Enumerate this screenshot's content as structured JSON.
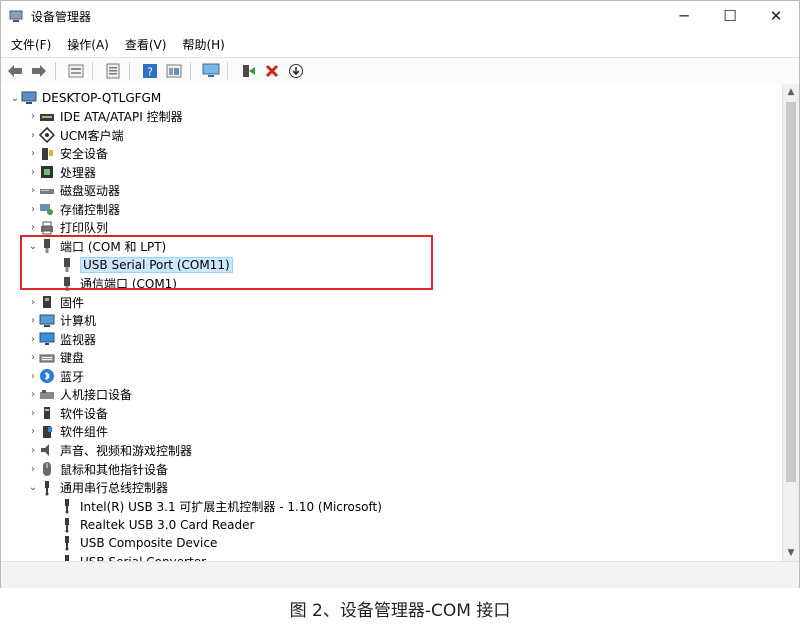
{
  "window": {
    "title": "设备管理器",
    "controls": {
      "minimize": "─",
      "maximize": "☐",
      "close": "✕"
    }
  },
  "menu": [
    "文件(F)",
    "操作(A)",
    "查看(V)",
    "帮助(H)"
  ],
  "toolbar": {
    "buttons": [
      {
        "name": "back-icon",
        "glyph": "⇦"
      },
      {
        "name": "forward-icon",
        "glyph": "⇨"
      },
      {
        "name": "properties-icon",
        "glyph": "▤"
      },
      {
        "name": "update-driver-icon",
        "glyph": "▦"
      },
      {
        "name": "help-icon",
        "glyph": "?"
      },
      {
        "name": "view-icon",
        "glyph": "▤"
      },
      {
        "name": "scan-hardware-icon",
        "glyph": "🖵"
      },
      {
        "name": "enable-device-icon",
        "glyph": "▲"
      },
      {
        "name": "uninstall-icon",
        "glyph": "✕"
      },
      {
        "name": "download-icon",
        "glyph": "⊕"
      }
    ]
  },
  "tree": {
    "root": "DESKTOP-QTLGFGM",
    "items": [
      {
        "label": "IDE ATA/ATAPI 控制器",
        "icon": "ide-controller-icon",
        "level": 1,
        "expander": "›"
      },
      {
        "label": "UCM客户端",
        "icon": "ucm-client-icon",
        "level": 1,
        "expander": "›"
      },
      {
        "label": "安全设备",
        "icon": "security-device-icon",
        "level": 1,
        "expander": "›"
      },
      {
        "label": "处理器",
        "icon": "processor-icon",
        "level": 1,
        "expander": "›"
      },
      {
        "label": "磁盘驱动器",
        "icon": "disk-drive-icon",
        "level": 1,
        "expander": "›"
      },
      {
        "label": "存储控制器",
        "icon": "storage-controller-icon",
        "level": 1,
        "expander": "›"
      },
      {
        "label": "打印队列",
        "icon": "printer-icon",
        "level": 1,
        "expander": "›"
      },
      {
        "label": "端口 (COM 和 LPT)",
        "icon": "port-icon",
        "level": 1,
        "expander": "⌄"
      },
      {
        "label": "USB Serial Port (COM11)",
        "icon": "port-icon",
        "level": 2,
        "expander": "",
        "selected": true
      },
      {
        "label": "通信端口 (COM1)",
        "icon": "port-icon",
        "level": 2,
        "expander": ""
      },
      {
        "label": "固件",
        "icon": "firmware-icon",
        "level": 1,
        "expander": "›"
      },
      {
        "label": "计算机",
        "icon": "computer-icon",
        "level": 1,
        "expander": "›"
      },
      {
        "label": "监视器",
        "icon": "monitor-icon",
        "level": 1,
        "expander": "›"
      },
      {
        "label": "键盘",
        "icon": "keyboard-icon",
        "level": 1,
        "expander": "›"
      },
      {
        "label": "蓝牙",
        "icon": "bluetooth-icon",
        "level": 1,
        "expander": "›"
      },
      {
        "label": "人机接口设备",
        "icon": "hid-icon",
        "level": 1,
        "expander": "›"
      },
      {
        "label": "软件设备",
        "icon": "software-device-icon",
        "level": 1,
        "expander": "›"
      },
      {
        "label": "软件组件",
        "icon": "software-component-icon",
        "level": 1,
        "expander": "›"
      },
      {
        "label": "声音、视频和游戏控制器",
        "icon": "audio-icon",
        "level": 1,
        "expander": "›"
      },
      {
        "label": "鼠标和其他指针设备",
        "icon": "mouse-icon",
        "level": 1,
        "expander": "›"
      },
      {
        "label": "通用串行总线控制器",
        "icon": "usb-icon",
        "level": 1,
        "expander": "⌄"
      },
      {
        "label": "Intel(R) USB 3.1 可扩展主机控制器 - 1.10 (Microsoft)",
        "icon": "usb-icon",
        "level": 2,
        "expander": ""
      },
      {
        "label": "Realtek USB 3.0 Card Reader",
        "icon": "usb-icon",
        "level": 2,
        "expander": ""
      },
      {
        "label": "USB Composite Device",
        "icon": "usb-icon",
        "level": 2,
        "expander": ""
      },
      {
        "label": "USB Serial Converter",
        "icon": "usb-icon",
        "level": 2,
        "expander": ""
      }
    ]
  },
  "caption": "图 2、设备管理器-COM 接口",
  "colors": {
    "highlight_box": "#d9272e",
    "selection": "#cce8ff"
  }
}
